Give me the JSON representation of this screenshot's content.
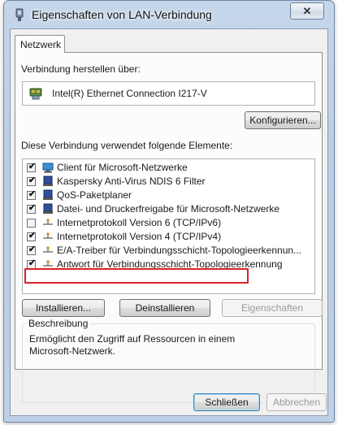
{
  "window": {
    "title": "Eigenschaften von LAN-Verbindung",
    "close_label": "✕"
  },
  "tabs": [
    {
      "label": "Netzwerk",
      "selected": true
    }
  ],
  "connect_using": {
    "label": "Verbindung herstellen über:",
    "adapter": "Intel(R) Ethernet Connection I217-V",
    "configure_button": "Konfigurieren..."
  },
  "components": {
    "label": "Diese Verbindung verwendet folgende Elemente:",
    "items": [
      {
        "label": "Client für Microsoft-Netzwerke",
        "checked": true,
        "icon": "network-client-icon"
      },
      {
        "label": "Kaspersky Anti-Virus NDIS 6 Filter",
        "checked": true,
        "icon": "service-icon"
      },
      {
        "label": "QoS-Paketplaner",
        "checked": true,
        "icon": "service-icon"
      },
      {
        "label": "Datei- und Druckerfreigabe für Microsoft-Netzwerke",
        "checked": true,
        "icon": "service-icon"
      },
      {
        "label": "Internetprotokoll Version 6 (TCP/IPv6)",
        "checked": false,
        "icon": "protocol-icon"
      },
      {
        "label": "Internetprotokoll Version 4 (TCP/IPv4)",
        "checked": true,
        "icon": "protocol-icon",
        "highlighted": true
      },
      {
        "label": "E/A-Treiber für Verbindungsschicht-Topologieerkennun...",
        "checked": true,
        "icon": "protocol-icon"
      },
      {
        "label": "Antwort für Verbindungsschicht-Topologieerkennung",
        "checked": true,
        "icon": "protocol-icon"
      }
    ],
    "install_button": "Installieren...",
    "uninstall_button": "Deinstallieren",
    "properties_button": "Eigenschaften"
  },
  "description": {
    "legend": "Beschreibung",
    "text": "Ermöglicht den Zugriff auf Ressourcen in einem Microsoft-Netzwerk."
  },
  "footer": {
    "close_button": "Schließen",
    "cancel_button": "Abbrechen"
  },
  "colors": {
    "highlight_border": "#d9222a",
    "title_gradient": "#c5d6ea"
  }
}
